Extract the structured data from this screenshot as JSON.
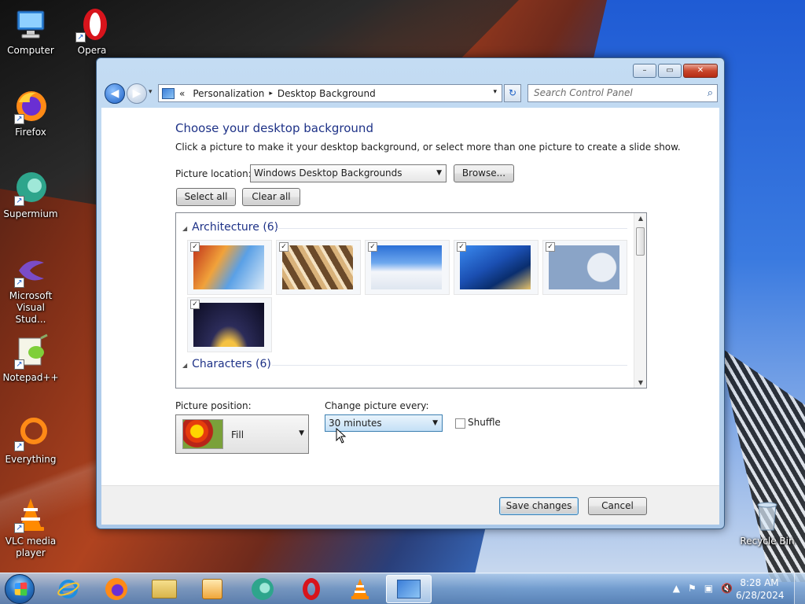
{
  "desktop": {
    "icons": [
      {
        "label": "Computer",
        "icon": "computer-icon"
      },
      {
        "label": "Opera",
        "icon": "opera-icon"
      },
      {
        "label": "Firefox",
        "icon": "firefox-icon"
      },
      {
        "label": "Supermium",
        "icon": "supermium-icon"
      },
      {
        "label": "Microsoft Visual Stud...",
        "icon": "visual-studio-icon"
      },
      {
        "label": "Notepad++",
        "icon": "notepadpp-icon"
      },
      {
        "label": "Everything",
        "icon": "everything-icon"
      },
      {
        "label": "VLC media player",
        "icon": "vlc-icon"
      },
      {
        "label": "Recycle Bin",
        "icon": "recycle-bin-icon"
      }
    ]
  },
  "window": {
    "caption": {
      "minimize": "–",
      "maximize": "▭",
      "close": "✕"
    },
    "nav": {
      "back": "◀",
      "forward": "▶",
      "recent": "▾"
    },
    "address": {
      "prefix": "«",
      "crumbs": [
        "Personalization",
        "Desktop Background"
      ],
      "sep": "▸",
      "dropdown": "▾"
    },
    "refresh": "↻",
    "search": {
      "placeholder": "Search Control Panel",
      "icon": "⌕"
    },
    "main": {
      "title": "Choose your desktop background",
      "description": "Click a picture to make it your desktop background, or select more than one picture to create a slide show.",
      "location_label": "Picture location:",
      "location_value": "Windows Desktop Backgrounds",
      "browse": "Browse...",
      "select_all": "Select all",
      "clear_all": "Clear all",
      "gallery": {
        "groups": [
          {
            "title": "Architecture (6)",
            "collapse_glyph": "◢"
          },
          {
            "title": "Characters (6)",
            "collapse_glyph": "◢"
          }
        ],
        "check_glyph": "✓",
        "thumbnail_count": 6
      },
      "position_label": "Picture position:",
      "position_value": "Fill",
      "interval_label": "Change picture every:",
      "interval_value": "30 minutes",
      "shuffle_label": "Shuffle",
      "dropdown_glyph": "▼"
    },
    "footer": {
      "save": "Save changes",
      "cancel": "Cancel"
    }
  },
  "taskbar": {
    "clock_time": "8:28 AM",
    "clock_date": "6/28/2024",
    "tray_glyphs": [
      "▲",
      "⚑",
      "▣",
      "🔇"
    ],
    "apps": [
      "internet-explorer-icon",
      "firefox-icon",
      "file-explorer-icon",
      "media-player-icon",
      "supermium-icon",
      "opera-icon",
      "vlc-icon",
      "control-panel-icon"
    ]
  },
  "colors": {
    "title_blue": "#1e3287",
    "accent": "#3c7fb1"
  }
}
